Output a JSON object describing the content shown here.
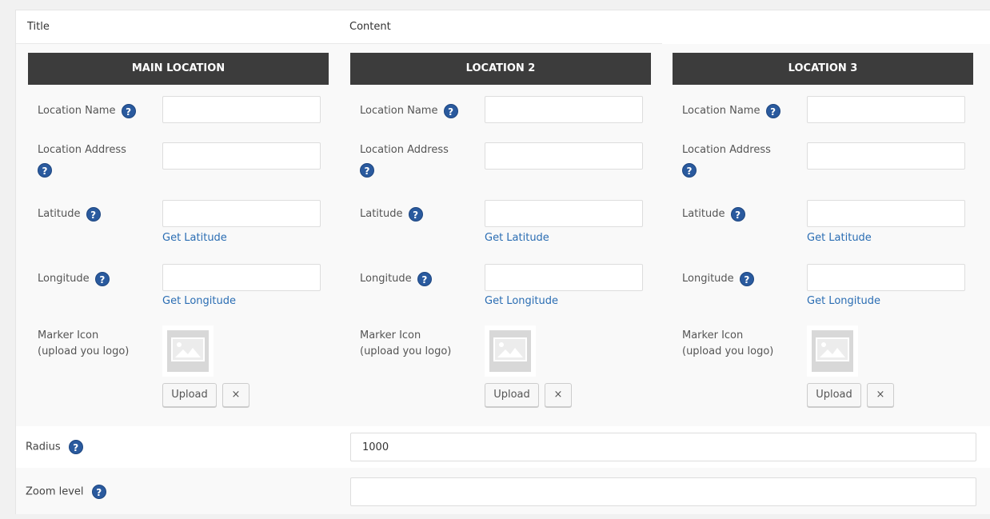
{
  "header": {
    "title_label": "Title",
    "content_label": "Content"
  },
  "fields": {
    "location_name": "Location Name",
    "location_address": "Location Address",
    "latitude": "Latitude",
    "longitude": "Longitude",
    "marker_icon_line1": "Marker Icon",
    "marker_icon_line2": "(upload you logo)",
    "get_latitude": "Get Latitude",
    "get_longitude": "Get Longitude",
    "upload": "Upload",
    "remove": "×",
    "help": "?"
  },
  "locations": [
    {
      "heading": "MAIN LOCATION"
    },
    {
      "heading": "LOCATION 2"
    },
    {
      "heading": "LOCATION 3"
    }
  ],
  "radius": {
    "label": "Radius",
    "value": "1000"
  },
  "zoom": {
    "label": "Zoom level",
    "value": ""
  },
  "colors": {
    "heading_bg": "#3c3c3c",
    "link": "#2a6db3",
    "help_icon": "#2a5a9e"
  }
}
